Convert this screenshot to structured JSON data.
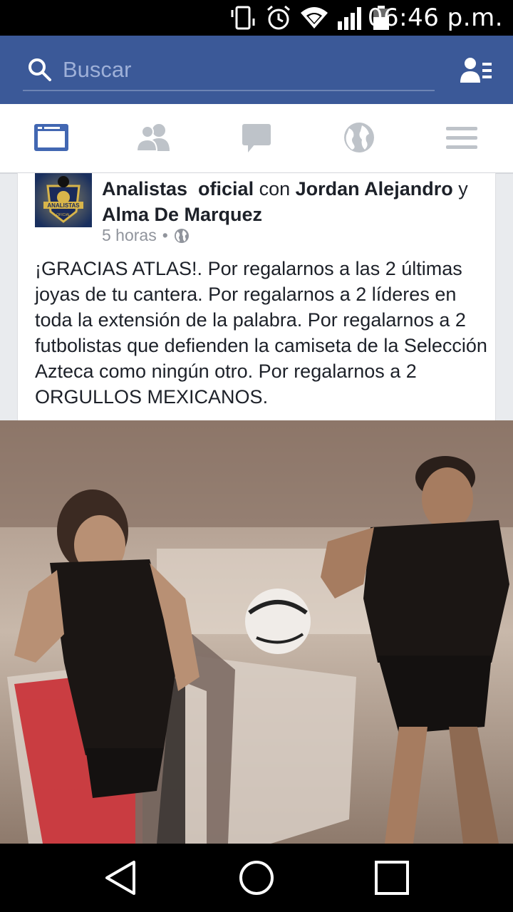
{
  "status_bar": {
    "time": "06:46 p.m.",
    "icons": [
      "vibrate-icon",
      "alarm-icon",
      "wifi-icon",
      "signal-icon",
      "battery-icon"
    ]
  },
  "header": {
    "search_placeholder": "Buscar",
    "search_icon": "search-icon",
    "contacts_icon": "contacts-icon"
  },
  "tabs": [
    {
      "name": "news-feed",
      "icon": "news-feed-icon",
      "active": true
    },
    {
      "name": "friends",
      "icon": "friends-icon",
      "active": false
    },
    {
      "name": "messages",
      "icon": "messages-icon",
      "active": false
    },
    {
      "name": "notifications",
      "icon": "globe-icon",
      "active": false
    },
    {
      "name": "menu",
      "icon": "menu-icon",
      "active": false
    }
  ],
  "post": {
    "author": "Analistas  oficial",
    "with_word": "con",
    "tagged_1": "Jordan Alejandro",
    "and_word": "y",
    "tagged_2": "Alma De Marquez",
    "time": "5 horas",
    "separator": "•",
    "audience_icon": "globe-icon",
    "avatar_text": "ANALISTAS",
    "avatar_subtext": "OFICIAL",
    "body": "¡GRACIAS ATLAS!. Por regalarnos a las 2 últimas joyas de tu cantera. Por regalarnos a 2 líderes en toda la extensión de la palabra. Por regalarnos a 2 futbolistas que defienden la camiseta de la Selección Azteca como ningún otro. Por regalarnos a 2 ORGULLOS MEXICANOS."
  },
  "nav": [
    "back-icon",
    "home-icon",
    "recents-icon"
  ],
  "colors": {
    "brand_blue": "#3b5998",
    "active_tab": "#4267b2",
    "inactive_tab": "#bec3c9",
    "atlas_red": "#c8242b"
  }
}
